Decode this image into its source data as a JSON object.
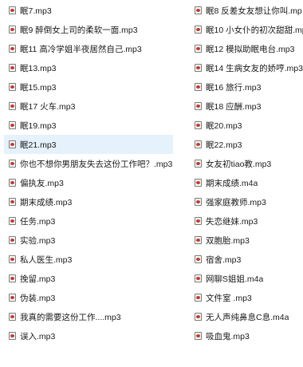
{
  "colors": {
    "selection": "#e5f1fb",
    "text": "#1a1a1a",
    "icon_accent": "#c0392b"
  },
  "icon": "audio-file-icon",
  "selected_index": 7,
  "files_left": [
    "眠7.mp3",
    "眠9 醉倒女上司的柔软一面.mp3",
    "眠11 高冷学姐半夜居然自己.mp3",
    "眠13.mp3",
    "眠15.mp3",
    "眠17 火车.mp3",
    "眠19.mp3",
    "眠21.mp3",
    "你也不想你男朋友失去这份工作吧？.mp3",
    "偏执友.mp3",
    "期末成绩.mp3",
    "任务.mp3",
    "实验.mp3",
    "私人医生.mp3",
    "挽留.mp3",
    "伪装.mp3",
    "我真的需要这份工作....mp3",
    "误入.mp3"
  ],
  "files_right": [
    "眠8 反差女友想让你叫.mp",
    "眠10 小女仆的初次甜甜.mp",
    "眠12 模拟助眠电台.mp3",
    "眠14 生病女友的娇哼.mp3",
    "眠16 旅行.mp3",
    "眠18 应酬.mp3",
    "眠20.mp3",
    "眠22.mp3",
    "女友初tiao教.mp3",
    "期末成绩.m4a",
    "强家庭教师.mp3",
    "失恋继妹.mp3",
    "双胞胎.mp3",
    "宿舍.mp3",
    "网聊S姐姐.m4a",
    "文件室 .mp3",
    "无人声纯鼻息C息.m4a",
    "吸血鬼.mp3"
  ]
}
